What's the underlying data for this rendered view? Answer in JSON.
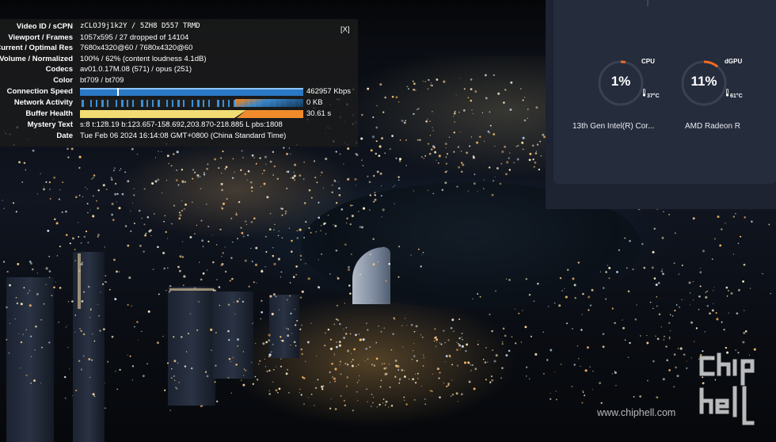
{
  "stats_panel": {
    "close_label": "[X]",
    "rows": [
      {
        "label": "Video ID / sCPN",
        "value": "zCLOJ9j1k2Y / 5ZH8 D557 TRMD"
      },
      {
        "label": "Viewport / Frames",
        "value": "1057x595 / 27 dropped of 14104"
      },
      {
        "label": "Current / Optimal Res",
        "value": "7680x4320@60 / 7680x4320@60"
      },
      {
        "label": "Volume / Normalized",
        "value": "100% / 62% (content loudness 4.1dB)"
      },
      {
        "label": "Codecs",
        "value": "av01.0.17M.08 (571) / opus (251)"
      },
      {
        "label": "Color",
        "value": "bt709 / bt709"
      },
      {
        "label": "Connection Speed",
        "value": "462957 Kbps"
      },
      {
        "label": "Network Activity",
        "value": "0 KB"
      },
      {
        "label": "Buffer Health",
        "value": "30.61 s"
      },
      {
        "label": "Mystery Text",
        "value": "s:8 t:128.19 b:123.657-158.692,203.870-218.885 L pbs:1808"
      },
      {
        "label": "Date",
        "value": "Tue Feb 06 2024 16:14:08 GMT+0800 (China Standard Time)"
      }
    ],
    "colors": {
      "connection": "#2b78c4",
      "network": "#3d8fd6",
      "buffer": "#f2dd74",
      "buffer_recent": "#f08b2c"
    }
  },
  "monitor": {
    "cpu": {
      "label": "CPU",
      "percent": "1%",
      "usage": 0.01,
      "temp": "37°C",
      "name": "13th Gen Intel(R) Cor..."
    },
    "gpu": {
      "label": "dGPU",
      "percent": "11%",
      "usage": 0.11,
      "temp": "61°C",
      "name": "AMD Radeon R"
    },
    "colors": {
      "ring_track": "#3a4152",
      "ring_active": "#f26b21",
      "panel": "#252c3b"
    }
  },
  "watermark": {
    "url": "www.chiphell.com",
    "logo_icon": "chiphell-logo-icon"
  }
}
